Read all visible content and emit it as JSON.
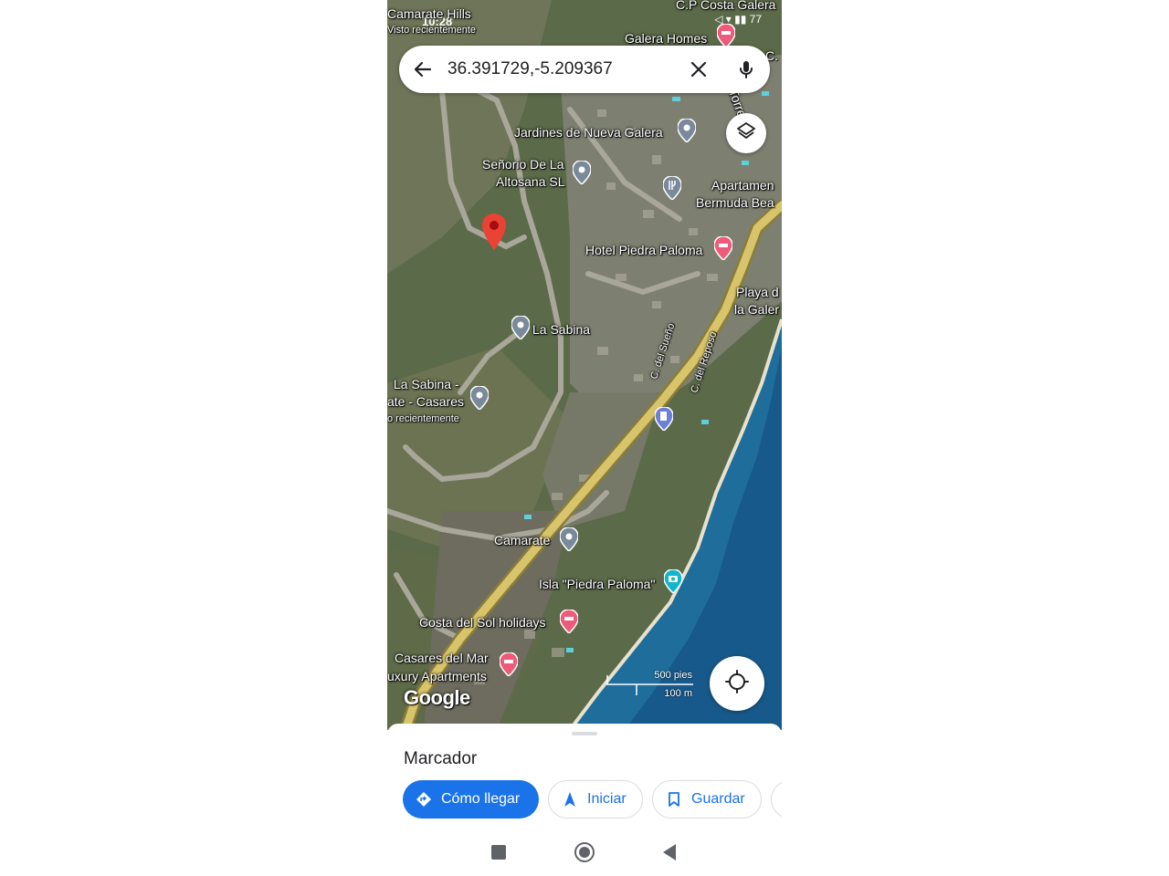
{
  "status_bar": {
    "time": "10:28",
    "icons": "◁ ▾ ▮▮ 77"
  },
  "search": {
    "query": "36.391729,-5.209367",
    "back_icon": "arrow-back-icon",
    "clear_icon": "close-icon",
    "mic_icon": "mic-icon"
  },
  "map": {
    "labels": {
      "camarate_hills": "Camarate Hills",
      "visto_recientemente": "Visto recientemente",
      "cp_costa_galera": "C.P Costa Galera",
      "galera_homes": "Galera Homes",
      "jardines": "Jardines de Nueva Galera",
      "senorio_line1": "Señorio De La",
      "senorio_line2": "Altosana SL",
      "apartamentos_line1": "Apartamen",
      "apartamentos_line2": "Bermuda Bea",
      "hotel_piedra_paloma": "Hotel Piedra Paloma",
      "playa_line1": "Playa d",
      "playa_line2": "la Galer",
      "la_sabina": "La Sabina",
      "c_del_sueno": "C. del Sueño",
      "c_del_reposo": "C. del Reposo",
      "la_sabina_casares_line1": "La Sabina -",
      "la_sabina_casares_line2": "ate - Casares",
      "visto_recientemente_2": "o recientemente",
      "camarate": "Camarate",
      "isla_piedra_paloma": "Isla \"Piedra Paloma\"",
      "costa_del_sol": "Costa del Sol holidays",
      "casares_line1": "Casares del Mar",
      "casares_line2": "uxury Apartments",
      "torre_partial": "Torre",
      "c_partial": "C."
    },
    "scale": {
      "imperial": "500 pies",
      "metric": "100 m"
    },
    "logo": "Google"
  },
  "sheet": {
    "title": "Marcador",
    "actions": [
      {
        "label": "Cómo llegar",
        "icon": "directions-icon"
      },
      {
        "label": "Iniciar",
        "icon": "navigation-icon"
      },
      {
        "label": "Guardar",
        "icon": "bookmark-icon"
      }
    ]
  },
  "colors": {
    "accent": "#1a73e8",
    "marker": "#ea4335",
    "highway": "#d8c46a",
    "sea": "#1f6d9a"
  }
}
